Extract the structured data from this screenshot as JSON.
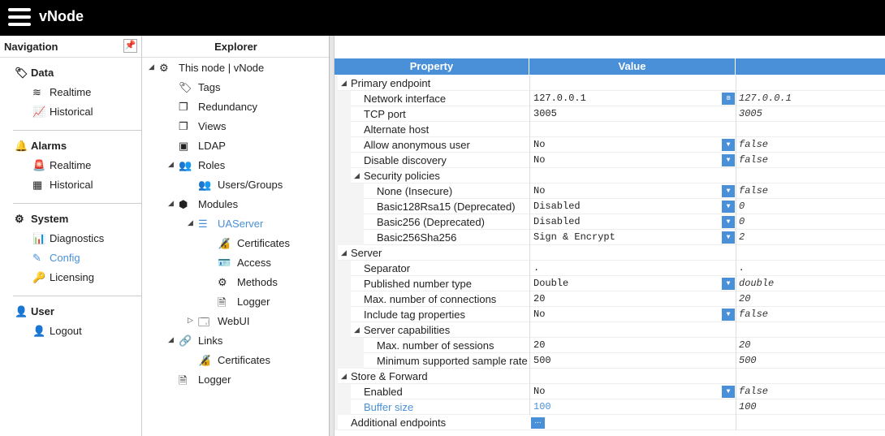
{
  "app": {
    "title": "vNode"
  },
  "navigation": {
    "title": "Navigation",
    "pin_icon": "pin-icon",
    "sections": [
      {
        "label": "Data",
        "icon": "tag-icon",
        "items": [
          {
            "label": "Realtime",
            "icon": "rss-icon"
          },
          {
            "label": "Historical",
            "icon": "line-chart-icon"
          }
        ]
      },
      {
        "label": "Alarms",
        "icon": "bell-icon",
        "items": [
          {
            "label": "Realtime",
            "icon": "alarm-light-icon"
          },
          {
            "label": "Historical",
            "icon": "table-icon"
          }
        ]
      },
      {
        "label": "System",
        "icon": "gear-icon",
        "items": [
          {
            "label": "Diagnostics",
            "icon": "pulse-icon"
          },
          {
            "label": "Config",
            "icon": "edit-icon",
            "active": true
          },
          {
            "label": "Licensing",
            "icon": "key-icon"
          }
        ]
      },
      {
        "label": "User",
        "icon": "user-icon",
        "items": [
          {
            "label": "Logout",
            "icon": "user-x-icon"
          }
        ]
      }
    ]
  },
  "explorer": {
    "title": "Explorer",
    "tree": [
      {
        "label": "This node | vNode",
        "icon": "cogs-icon"
      },
      {
        "label": "Tags",
        "icon": "tag-icon"
      },
      {
        "label": "Redundancy",
        "icon": "copy-icon"
      },
      {
        "label": "Views",
        "icon": "windows-icon"
      },
      {
        "label": "LDAP",
        "icon": "contact-icon"
      },
      {
        "label": "Roles",
        "icon": "users-icon"
      },
      {
        "label": "Users/Groups",
        "icon": "group-icon"
      },
      {
        "label": "Modules",
        "icon": "cubes-icon"
      },
      {
        "label": "UAServer",
        "icon": "server-icon",
        "selected": true
      },
      {
        "label": "Certificates",
        "icon": "certificate-icon"
      },
      {
        "label": "Access",
        "icon": "id-card-icon"
      },
      {
        "label": "Methods",
        "icon": "gear-icon"
      },
      {
        "label": "Logger",
        "icon": "document-icon"
      },
      {
        "label": "WebUI",
        "icon": "browser-icon"
      },
      {
        "label": "Links",
        "icon": "link-icon"
      },
      {
        "label": "Certificates",
        "icon": "certificate-icon"
      },
      {
        "label": "Logger",
        "icon": "document-icon"
      }
    ]
  },
  "grid": {
    "headers": {
      "property": "Property",
      "value": "Value",
      "default": ""
    },
    "rows": [
      {
        "property": "Primary endpoint",
        "value": "",
        "default": ""
      },
      {
        "property": "Network interface",
        "value": "127.0.0.1",
        "default": "127.0.0.1"
      },
      {
        "property": "TCP port",
        "value": "3005",
        "default": "3005"
      },
      {
        "property": "Alternate host",
        "value": "",
        "default": ""
      },
      {
        "property": "Allow anonymous user",
        "value": "No",
        "default": "false"
      },
      {
        "property": "Disable discovery",
        "value": "No",
        "default": "false"
      },
      {
        "property": "Security policies",
        "value": "",
        "default": ""
      },
      {
        "property": "None (Insecure)",
        "value": "No",
        "default": "false"
      },
      {
        "property": "Basic128Rsa15 (Deprecated)",
        "value": "Disabled",
        "default": "0"
      },
      {
        "property": "Basic256 (Deprecated)",
        "value": "Disabled",
        "default": "0"
      },
      {
        "property": "Basic256Sha256",
        "value": "Sign & Encrypt",
        "default": "2"
      },
      {
        "property": "Server",
        "value": "",
        "default": ""
      },
      {
        "property": "Separator",
        "value": ".",
        "default": "."
      },
      {
        "property": "Published number type",
        "value": "Double",
        "default": "double"
      },
      {
        "property": "Max. number of connections",
        "value": "20",
        "default": "20"
      },
      {
        "property": "Include tag properties",
        "value": "No",
        "default": "false"
      },
      {
        "property": "Server capabilities",
        "value": "",
        "default": ""
      },
      {
        "property": "Max. number of sessions",
        "value": "20",
        "default": "20"
      },
      {
        "property": "Minimum supported sample rate",
        "value": "500",
        "default": "500"
      },
      {
        "property": "Store & Forward",
        "value": "",
        "default": ""
      },
      {
        "property": "Enabled",
        "value": "No",
        "default": "false"
      },
      {
        "property": "Buffer size",
        "value": "100",
        "default": "100"
      },
      {
        "property": "Additional endpoints",
        "value": "...",
        "default": ""
      }
    ]
  }
}
